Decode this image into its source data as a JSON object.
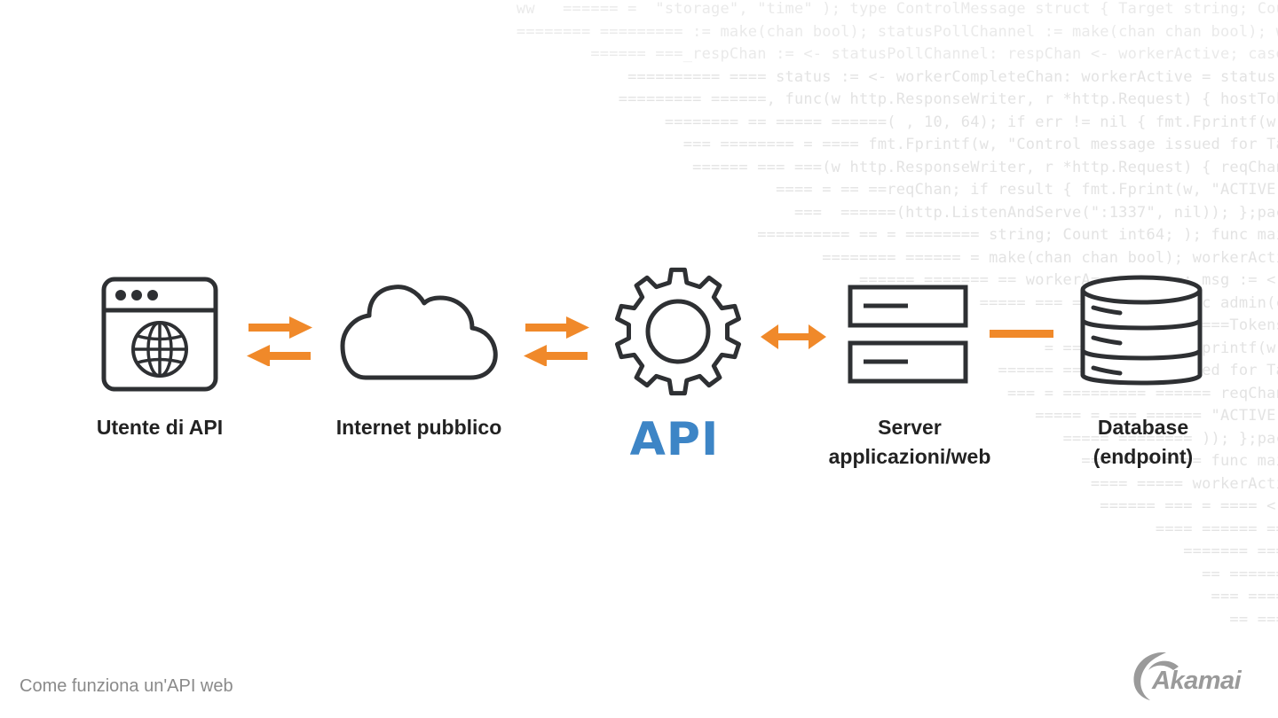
{
  "diagram": {
    "nodes": [
      {
        "id": "api-user",
        "label": "Utente di API",
        "icon": "browser-globe-icon"
      },
      {
        "id": "public-internet",
        "label": "Internet pubblico",
        "icon": "cloud-icon"
      },
      {
        "id": "api",
        "label": "API",
        "icon": "gear-icon"
      },
      {
        "id": "app-server",
        "label_line1": "Server",
        "label_line2": "applicazioni/web",
        "icon": "server-icon"
      },
      {
        "id": "database",
        "label_line1": "Database",
        "label_line2": "(endpoint)",
        "icon": "database-icon"
      }
    ],
    "connectors": [
      {
        "from": "api-user",
        "to": "public-internet",
        "type": "exchange-arrows"
      },
      {
        "from": "public-internet",
        "to": "api",
        "type": "exchange-arrows"
      },
      {
        "from": "api",
        "to": "app-server",
        "type": "double-headed-arrow"
      },
      {
        "from": "app-server",
        "to": "database",
        "type": "line"
      }
    ],
    "colors": {
      "accent_orange": "#f0892a",
      "api_blue": "#3d85c6",
      "icon_stroke": "#2e3033",
      "label_text": "#222222",
      "caption_gray": "#8a8a8a"
    }
  },
  "footer": {
    "caption": "Come funziona un'API web",
    "brand": "Akamai"
  },
  "background_code": [
    "ww   ====== =  \"storage\", \"time\" ); type ControlMessage struct { Target string; Cou",
    "======== ========= := make(chan bool); statusPollChannel := make(chan chan bool); w",
    "====== ===_respChan := <- statusPollChannel: respChan <- workerActive; case",
    "========== ==== status := <- workerCompleteChan: workerActive = status;",
    "========= ======, func(w http.ResponseWriter, r *http.Request) { hostTok",
    "======== == ===== ======( , 10, 64); if err != nil { fmt.Fprintf(w,",
    "=== ======== = ==== fmt.Fprintf(w, \"Control message issued for Ta",
    "====== === ===(w http.ResponseWriter, r *http.Request) { reqChan",
    "==== = == ==reqChan; if result { fmt.Fprint(w, \"ACTIVE\"",
    "===  ======(http.ListenAndServe(\":1337\", nil)); };pac",
    "========== == = ======== string; Count int64; ); func mai",
    "======== ====== = make(chan chan bool); workerActi",
    "====== ======= == workerA===== ====: msg := <-",
    "===== === = ======== func admin(c",
    "========= ===Tokens",
    "= ==== ==== fmt.Fprintf(w,",
    "====== ==== ===== issued for Ta",
    "=== = ========= ====== reqChan",
    "===== = === ====== \"ACTIVE\"",
    "===== ======== )); };pac",
    "====== = ==== func mai",
    "==== ===== workerActi",
    "====== === = ==== <-",
    "==== ====== ==",
    "======= ===",
    "== ======",
    "=== ====",
    "== ==="
  ]
}
